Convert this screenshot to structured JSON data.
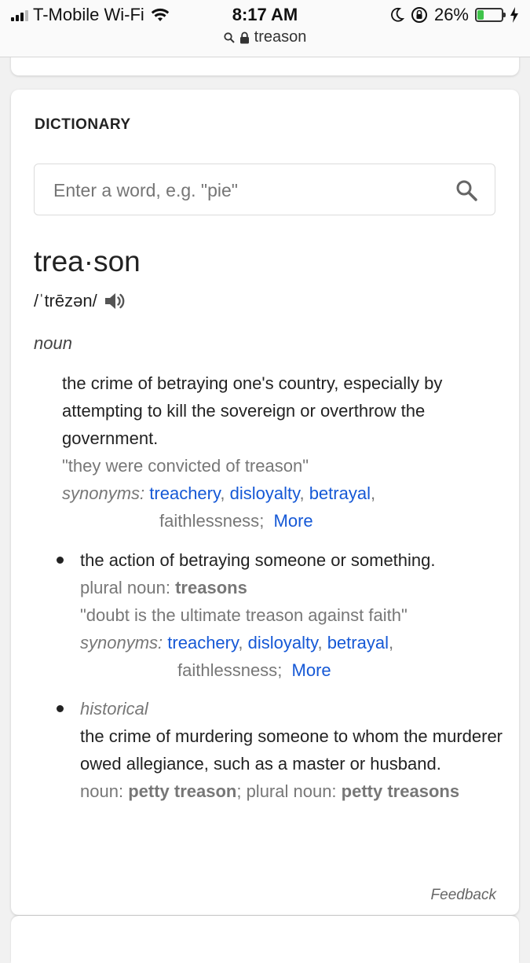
{
  "status_bar": {
    "carrier": "T-Mobile Wi-Fi",
    "time": "8:17 AM",
    "battery_percent": "26%",
    "battery_level": 0.26,
    "battery_color": "#3fc34a",
    "icons": [
      "signal-icon",
      "wifi-icon",
      "moon-icon",
      "rotation-lock-icon",
      "battery-icon",
      "charging-bolt-icon"
    ]
  },
  "url_bar": {
    "query": "treason",
    "icons": [
      "search-icon",
      "lock-icon"
    ]
  },
  "dictionary": {
    "section_title": "DICTIONARY",
    "search_placeholder": "Enter a word, e.g. \"pie\"",
    "search_value": "",
    "headword": "trea·son",
    "pronunciation": "/ˈtrēzən/",
    "part_of_speech": "noun",
    "senses": [
      {
        "definition": "the crime of betraying one's country, especially by attempting to kill the sovereign or overthrow the government.",
        "example": "\"they were convicted of treason\"",
        "synonyms_label": "synonyms:",
        "synonyms": [
          "treachery",
          "disloyalty",
          "betrayal",
          "faithlessness"
        ],
        "more_label": "More"
      },
      {
        "definition": "the action of betraying someone or something.",
        "plural_label": "plural noun:",
        "plural_value": "treasons",
        "example": "\"doubt is the ultimate treason against faith\"",
        "synonyms_label": "synonyms:",
        "synonyms": [
          "treachery",
          "disloyalty",
          "betrayal",
          "faithlessness"
        ],
        "more_label": "More"
      },
      {
        "register": "historical",
        "definition": "the crime of murdering someone to whom the murderer owed allegiance, such as a master or husband.",
        "noun_label": "noun:",
        "noun_value": "petty treason",
        "plural_label": "; plural noun:",
        "plural_value_1": "petty",
        "plural_value_2": "treasons"
      }
    ],
    "feedback_label": "Feedback"
  },
  "colors": {
    "link": "#1558d6",
    "muted_text": "#777777",
    "card_background": "#ffffff",
    "page_background": "#f1f1f1"
  }
}
